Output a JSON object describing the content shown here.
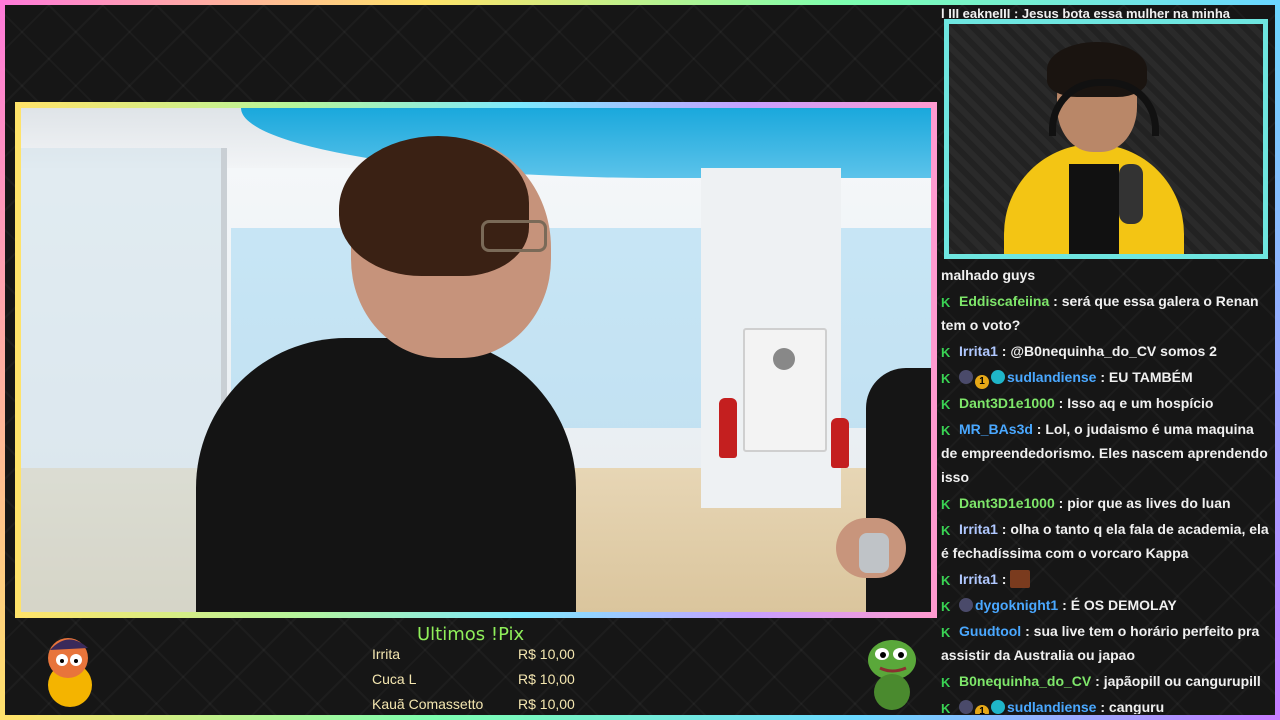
{
  "chat": {
    "top_partial": "l III eakneIII : Jesus bota essa mulher na minha",
    "messages": [
      {
        "user": "",
        "user_color": "#f0f0f0",
        "text": "malhado guys",
        "badges": []
      },
      {
        "user": "Eddiscafeiina",
        "user_color": "#7ee66a",
        "text": "será que essa galera o Renan tem o voto?",
        "badges": [
          "k"
        ]
      },
      {
        "user": "Irrita1",
        "user_color": "#b0c8ff",
        "text": "@B0nequinha_do_CV somos 2",
        "badges": [
          "k"
        ]
      },
      {
        "user": "sudlandiense",
        "user_color": "#4aa8ff",
        "text": "EU TAMBÉM",
        "badges": [
          "k",
          "gray",
          "gold",
          "cyan"
        ]
      },
      {
        "user": "Dant3D1e1000",
        "user_color": "#7ee66a",
        "text": "Isso aq e um hospício",
        "badges": [
          "k"
        ]
      },
      {
        "user": "MR_BAs3d",
        "user_color": "#4aa8ff",
        "text": "Lol, o judaismo é uma maquina de empreendedorismo. Eles nascem aprendendo isso",
        "badges": [
          "k"
        ]
      },
      {
        "user": "Dant3D1e1000",
        "user_color": "#7ee66a",
        "text": "pior que as lives do luan",
        "badges": [
          "k"
        ]
      },
      {
        "user": "Irrita1",
        "user_color": "#b0c8ff",
        "text": "olha o tanto q ela fala de academia, ela é fechadíssima com o vorcaro Kappa",
        "badges": [
          "k"
        ]
      },
      {
        "user": "Irrita1",
        "user_color": "#b0c8ff",
        "text": "",
        "badges": [
          "k"
        ],
        "emote": true
      },
      {
        "user": "dygoknight1",
        "user_color": "#4aa8ff",
        "text": "É OS DEMOLAY",
        "badges": [
          "k",
          "gray"
        ]
      },
      {
        "user": "Guudtool",
        "user_color": "#4aa8ff",
        "text": "sua live tem o horário perfeito pra assistir da Australia ou japao",
        "badges": [
          "k"
        ]
      },
      {
        "user": "B0nequinha_do_CV",
        "user_color": "#7ee66a",
        "text": "japãopill ou cangurupill",
        "badges": [
          "k"
        ]
      },
      {
        "user": "sudlandiense",
        "user_color": "#4aa8ff",
        "text": "canguru",
        "badges": [
          "k",
          "gray",
          "gold",
          "cyan"
        ]
      }
    ]
  },
  "pix": {
    "title": "Ultimos !Pix",
    "rows": [
      {
        "name": "Irrita",
        "amount": "R$ 10,00"
      },
      {
        "name": "Cuca L",
        "amount": "R$ 10,00"
      },
      {
        "name": "Kauã Comassetto",
        "amount": "R$ 10,00"
      }
    ]
  },
  "colors": {
    "frame_gradient": [
      "#ff7ad9",
      "#ffe36a",
      "#7dffb0",
      "#6ad8ff",
      "#c77dff"
    ],
    "webcam_border": "#6ee6e0",
    "pix_title": "#8fef5a",
    "pix_text": "#f4e6b0",
    "badge_green": "#39d353"
  }
}
